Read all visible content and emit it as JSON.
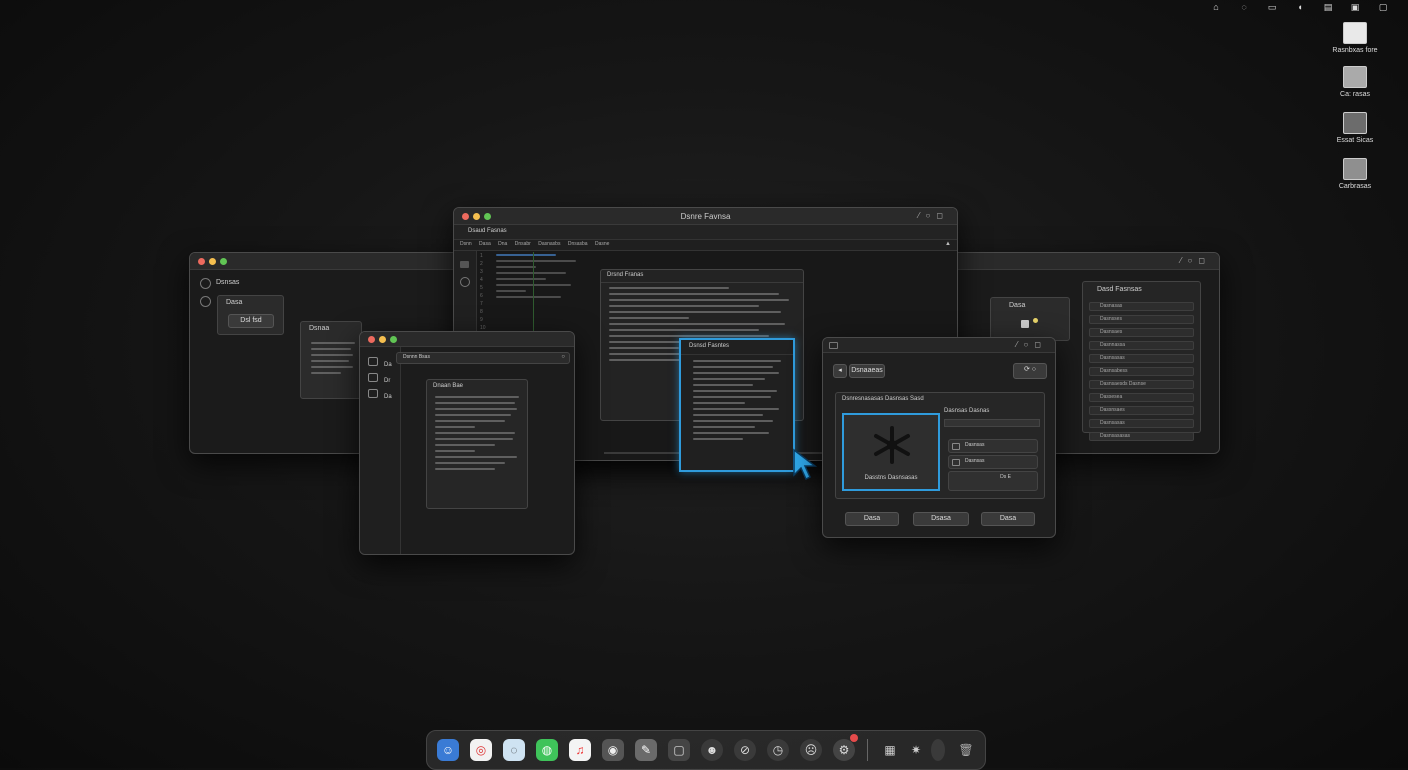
{
  "desktop": {
    "icons": [
      {
        "label": "Rasnbxas fore",
        "icon": "document-icon"
      },
      {
        "label": "Ca: rasas",
        "icon": "archive-icon"
      },
      {
        "label": "Essat Sicas",
        "icon": "network-icon"
      },
      {
        "label": "Carbrasas",
        "icon": "drive-icon"
      }
    ]
  },
  "windows": {
    "center": {
      "title": "Dsnre Favnsa",
      "toolbar_label": "Dsaud Fasnas",
      "tabs": [
        "Dsnn Dasa",
        "Dna",
        "Dnsabr",
        "Dasnasbs",
        "Dnsasba",
        "Dasne"
      ],
      "popup_title": "Drsnd Franas"
    },
    "left": {
      "heading": "Dsnsas",
      "box_title": "Dasa",
      "box_field": "Dsl fsd",
      "popup_title": "Dsnaa"
    },
    "small": {
      "search_placeholder": "Dsnnn Bsas",
      "sidebar_items": [
        "Da",
        "Dr",
        "Da"
      ],
      "doc_title": "Dnaan Bae"
    },
    "highlight_doc": {
      "title": "Dsnsd Fasntes"
    },
    "right": {
      "box_title": "Dasa",
      "list_title": "Dasd Fasnsas",
      "list_items": [
        "Dasnasas",
        "Dasnsses",
        "Dasnsaes",
        "Dasnnassa",
        "Dasnsasas",
        "Dasnsabess",
        "Dasnsaesds Dasnse",
        "Dassesea",
        "Dassnsaes",
        "Dasnsasas",
        "Dasnsasasas"
      ]
    },
    "dialog": {
      "toolbar_label": "Dsnaaeas",
      "section_title": "Dsnresnasasas Dasnsas Sasd",
      "preview_label": "Dasstns Dasnsasas",
      "side_title": "Dasnsas Dasnas",
      "options": [
        "Dasnsas",
        "Dasnsas"
      ],
      "small_value": "Ds E",
      "buttons": [
        "Dasa",
        "Dsasa",
        "Dasa"
      ]
    }
  }
}
